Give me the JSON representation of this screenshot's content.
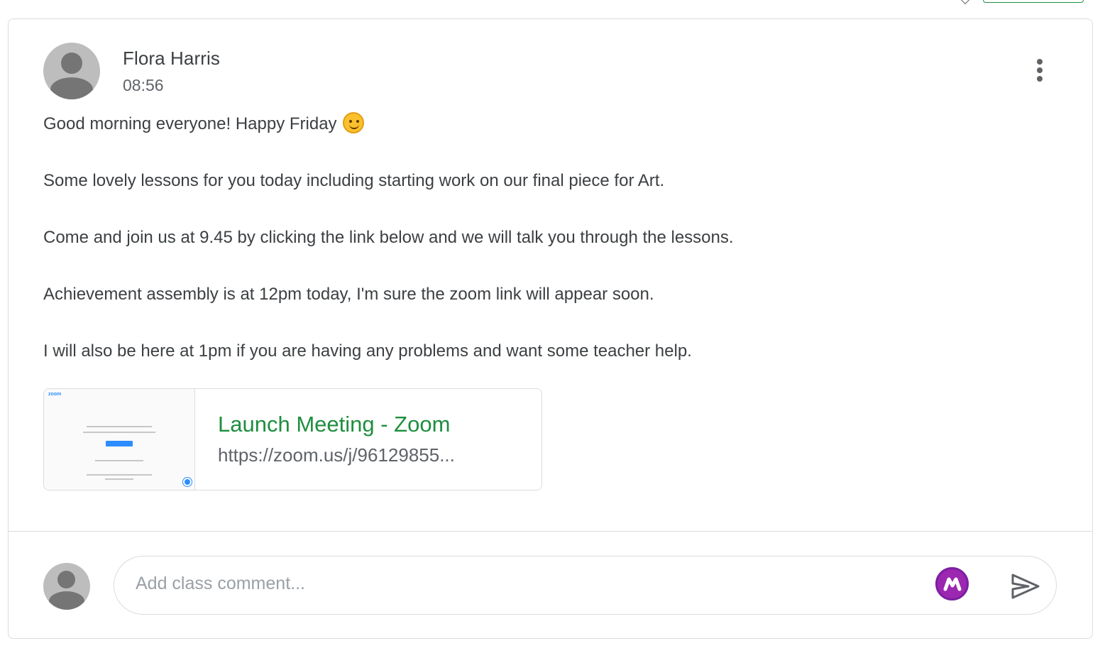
{
  "post": {
    "author": "Flora Harris",
    "time": "08:56",
    "lines": [
      "Good morning everyone! Happy Friday",
      "Some lovely lessons for you today including starting work on our final piece for Art.",
      "Come and join us at 9.45 by clicking the link below and we will talk you through the lessons.",
      "Achievement assembly is at 12pm today, I'm sure the zoom link will appear soon.",
      "I will also be here at 1pm if you are having any problems and want some teacher help."
    ],
    "emoji_icon": "smiling-face-icon",
    "menu_icon": "more-vert-icon"
  },
  "attachment": {
    "title": "Launch Meeting - Zoom",
    "url": "https://zoom.us/j/96129855...",
    "thumbnail_logo": "zoom"
  },
  "comment": {
    "placeholder": "Add class comment...",
    "extension_icon": "extension-icon",
    "send_icon": "send-icon"
  },
  "colors": {
    "accent_green": "#1e8e3e",
    "text": "#3c4043",
    "muted": "#5f6368",
    "border": "#dadce0",
    "extension_purple": "#9c27b0"
  }
}
